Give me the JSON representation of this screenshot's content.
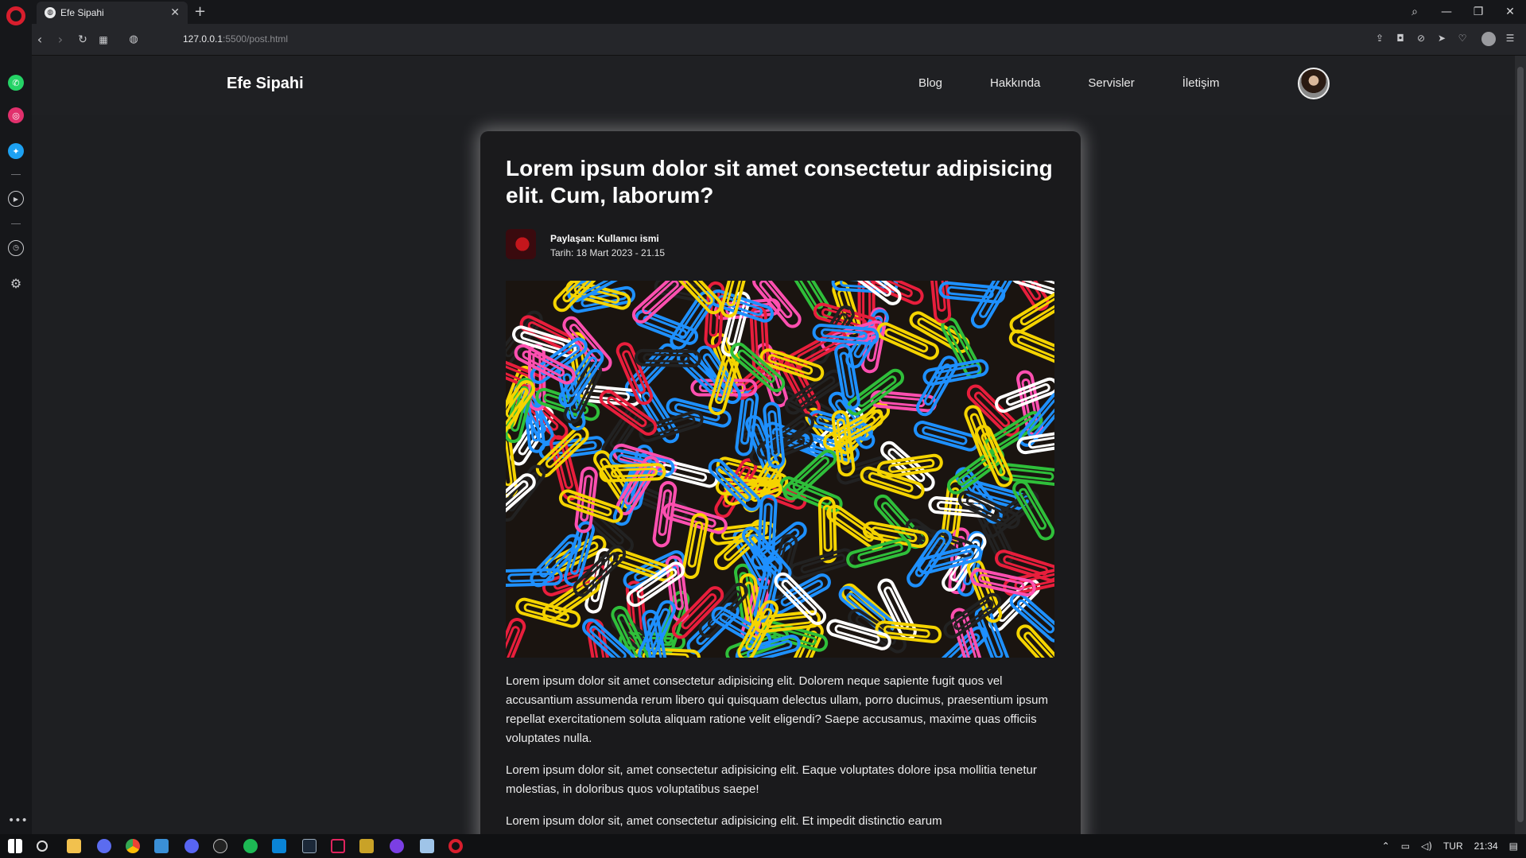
{
  "browser": {
    "tab_title": "Efe Sipahi",
    "tab_close_glyph": "✕",
    "new_tab_glyph": "+",
    "url_host": "127.0.0.1",
    "url_rest": ":5500/post.html",
    "window_controls": [
      "⌕",
      "—",
      "❐",
      "✕"
    ]
  },
  "site": {
    "brand": "Efe Sipahi",
    "nav": [
      "Blog",
      "Hakkında",
      "Servisler",
      "İletişim"
    ]
  },
  "post": {
    "title": "Lorem ipsum dolor sit amet consectetur adipisicing elit. Cum, laborum?",
    "author": "Paylaşan: Kullanıcı ismi",
    "date": "Tarih: 18 Mart 2023 - 21.15",
    "paragraphs": [
      "Lorem ipsum dolor sit amet consectetur adipisicing elit. Dolorem neque sapiente fugit quos vel accusantium assumenda rerum libero qui quisquam delectus ullam, porro ducimus, praesentium ipsum repellat exercitationem soluta aliquam ratione velit eligendi? Saepe accusamus, maxime quas officiis voluptates nulla.",
      "Lorem ipsum dolor sit, amet consectetur adipisicing elit. Eaque voluptates dolore ipsa mollitia tenetur molestias, in doloribus quos voluptatibus saepe!",
      "Lorem ipsum dolor sit, amet consectetur adipisicing elit. Et impedit distinctio earum"
    ]
  },
  "taskbar": {
    "language": "TUR",
    "time": "21:34"
  },
  "colors": {
    "opera_red": "#d81e2d",
    "whatsapp": "#25d366",
    "instagram": "#e1306c",
    "twitter": "#1da1f2",
    "card_bg": "#1a1a1c"
  }
}
